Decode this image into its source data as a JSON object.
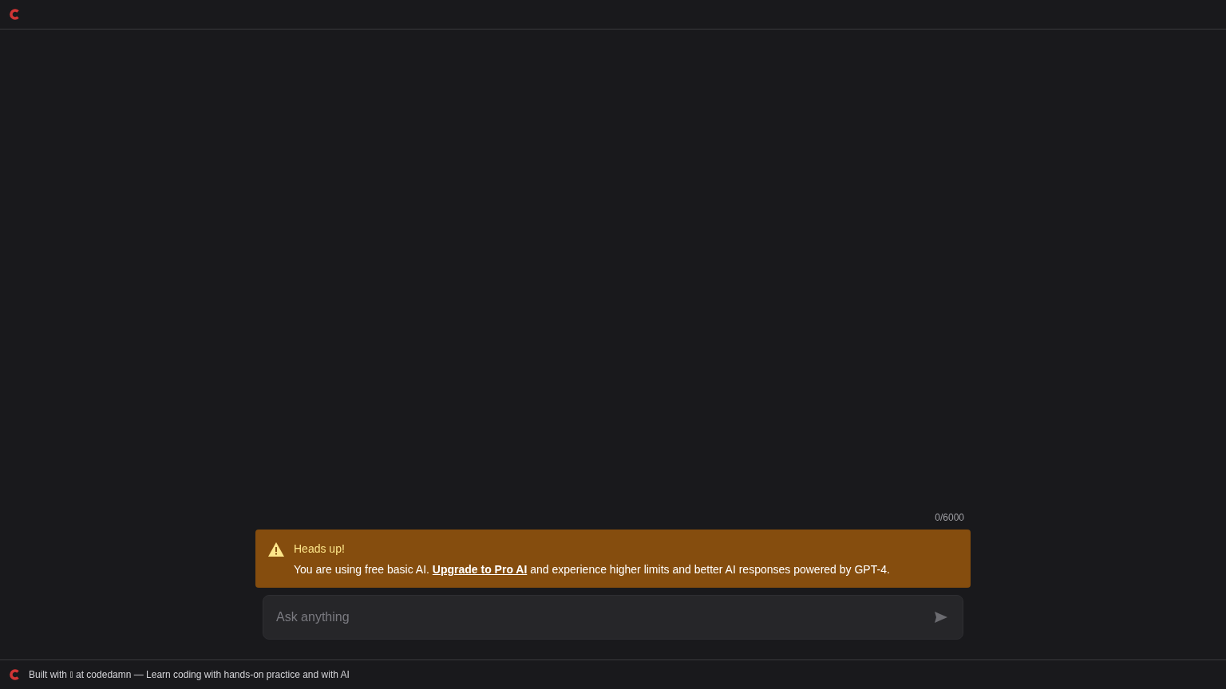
{
  "footer": {
    "before_icon": "Built with",
    "after_icon": "at codedamn — Learn coding with hands-on practice and with AI"
  },
  "composer": {
    "counter": "0/6000",
    "placeholder": "Ask anything"
  },
  "alert": {
    "title": "Heads up!",
    "text_before": "You are using free basic AI.",
    "link": "Upgrade to Pro AI",
    "text_after": "and experience higher limits and better AI responses powered by GPT-4."
  }
}
